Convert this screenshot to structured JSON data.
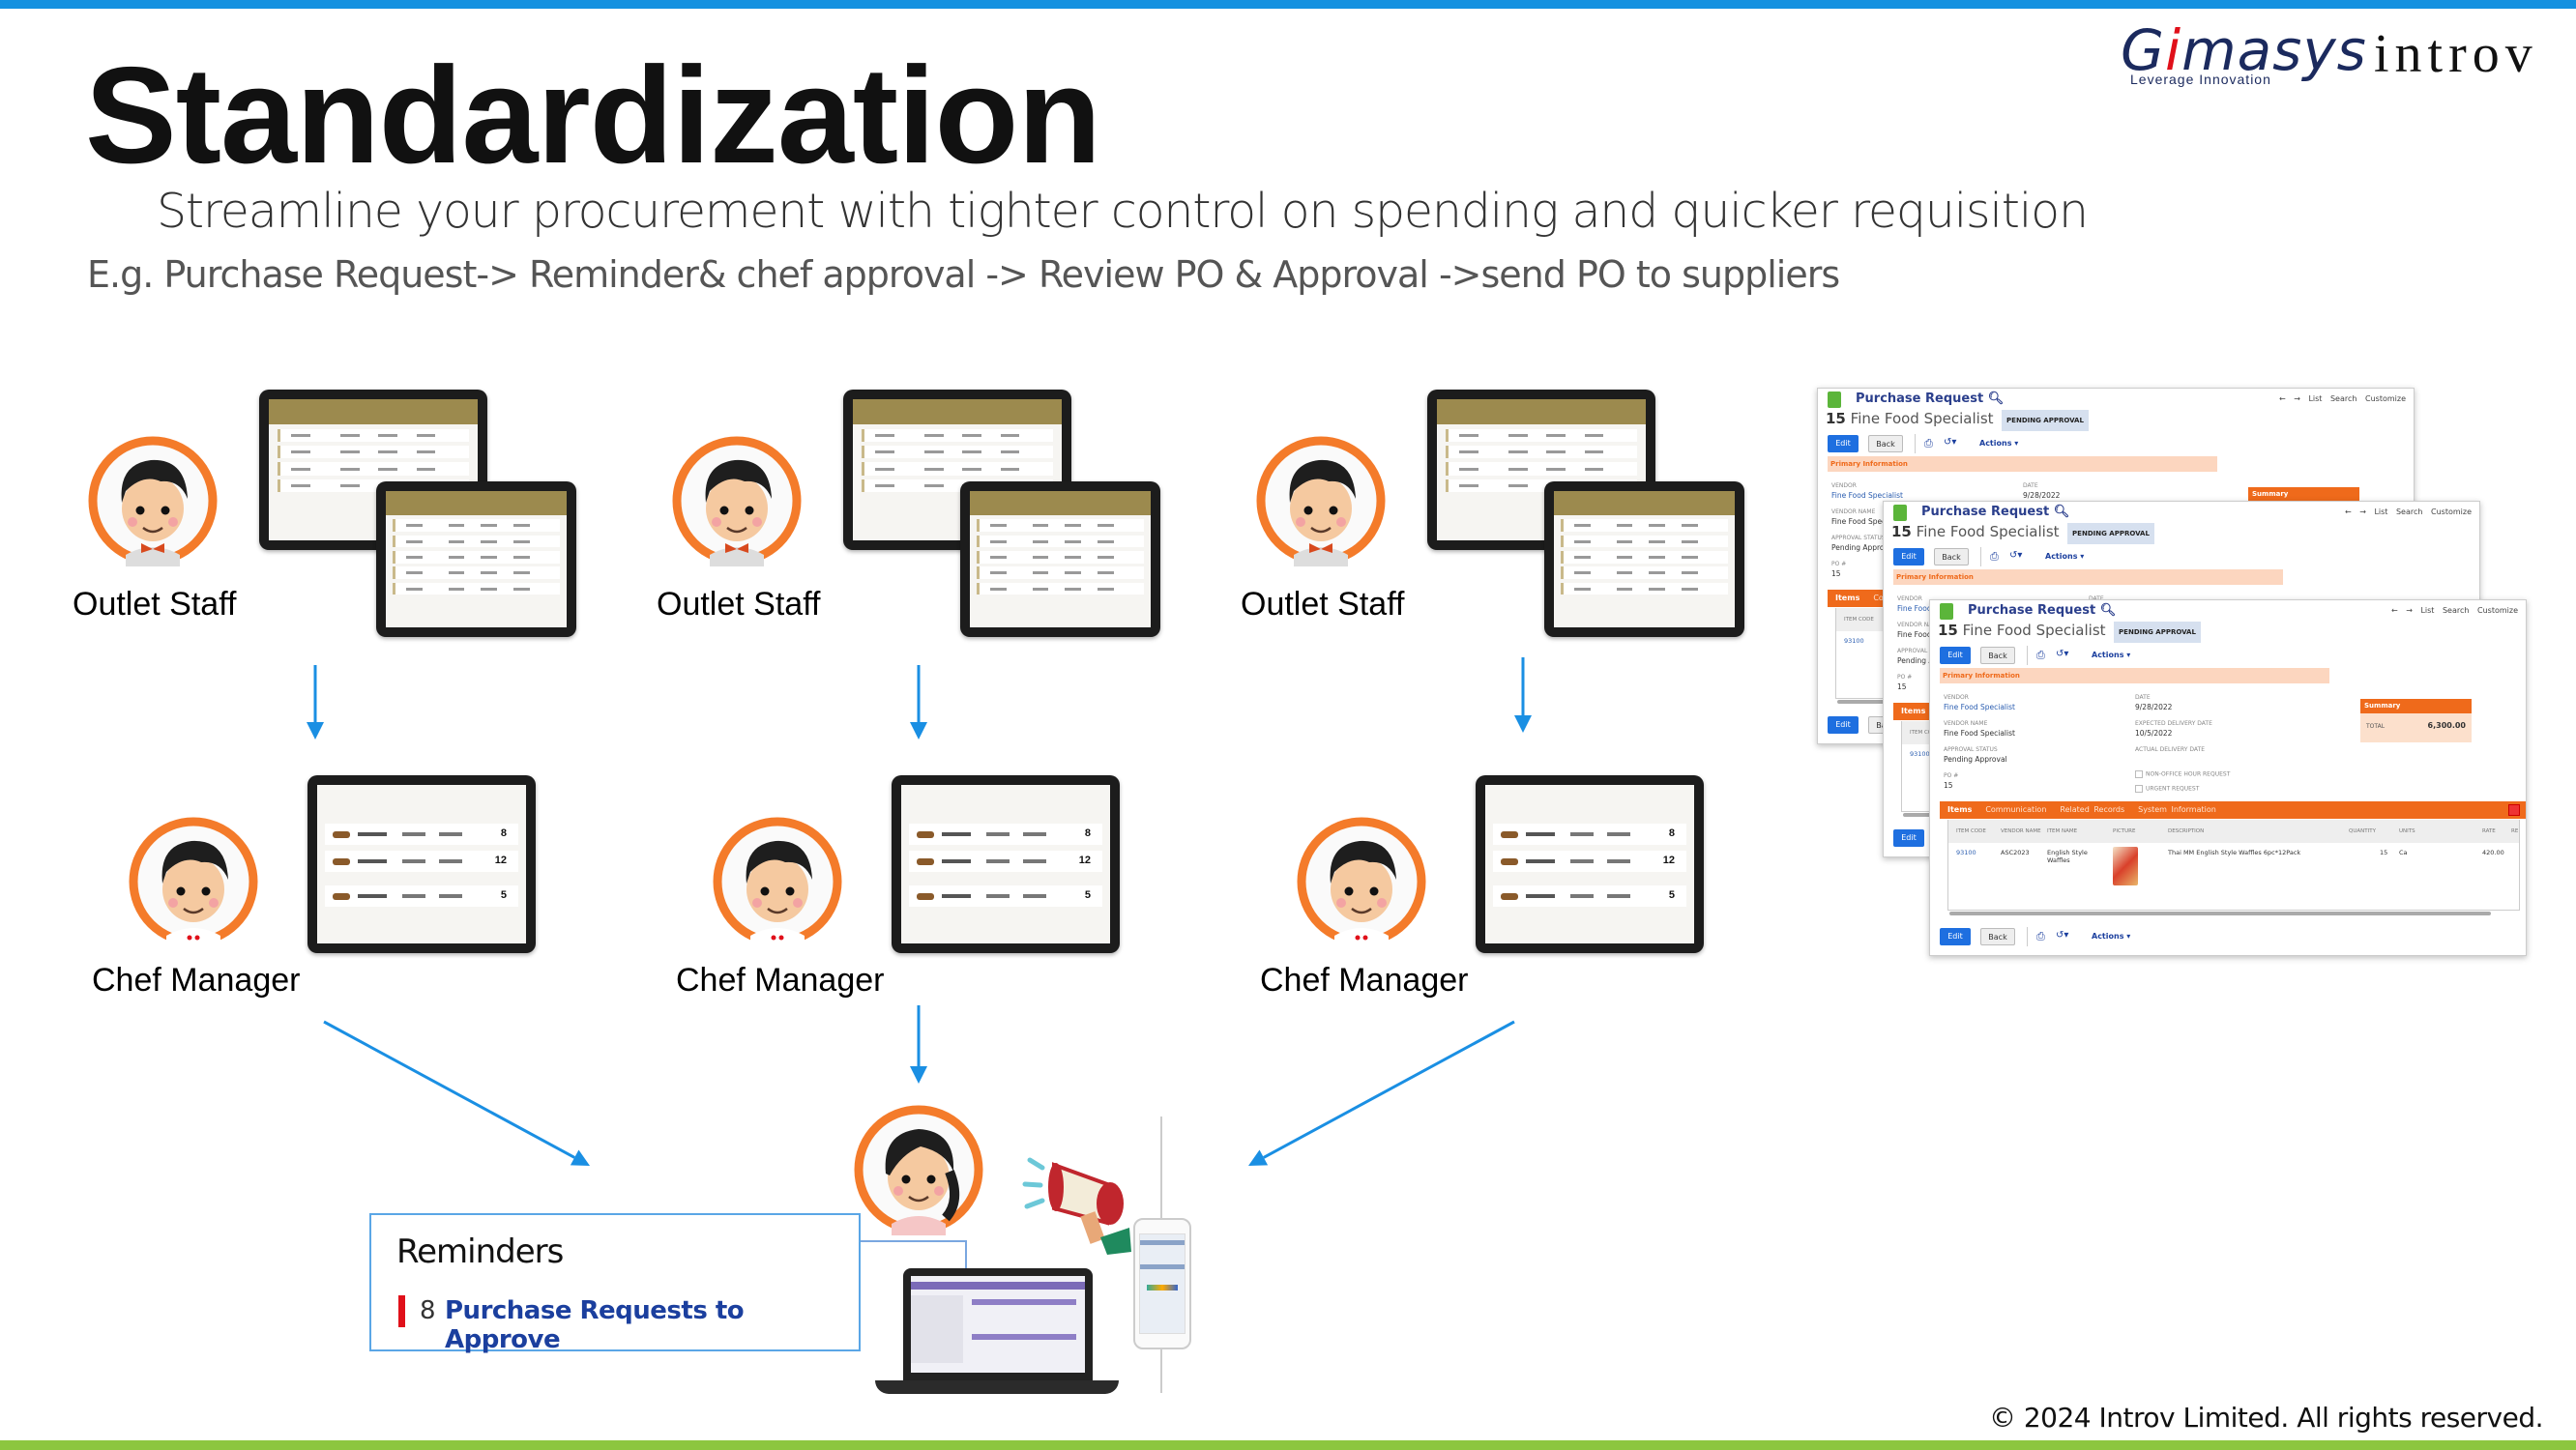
{
  "header": {
    "title": "Standardization",
    "subtitle": "Streamline your procurement with tighter control on spending and quicker requisition",
    "example": "E.g. Purchase Request-> Reminder& chef approval -> Review PO  & Approval ->send PO to suppliers"
  },
  "logos": {
    "gimasys_pre": "G",
    "gimasys_i": "i",
    "gimasys_post": "masys",
    "gimasys_tagline": "Leverage Innovation",
    "introv": "introv"
  },
  "colors": {
    "top_bar": "#1591e0",
    "bottom_bar": "#8cc63f",
    "avatar_ring": "#f47b2a",
    "arrow": "#1a8fe3",
    "pr_accent": "#ef6a1b"
  },
  "flows": [
    {
      "staff_label": "Outlet Staff",
      "manager_label": "Chef Manager",
      "quantities": [
        "8",
        "12",
        "5"
      ]
    },
    {
      "staff_label": "Outlet Staff",
      "manager_label": "Chef Manager",
      "quantities": [
        "8",
        "12",
        "5"
      ]
    },
    {
      "staff_label": "Outlet Staff",
      "manager_label": "Chef Manager",
      "quantities": [
        "8",
        "12",
        "5"
      ]
    }
  ],
  "reminders": {
    "title": "Reminders",
    "count": "8",
    "link": "Purchase Requests to Approve"
  },
  "purchase_request": {
    "title": "Purchase Request",
    "number": "15",
    "vendor_title": "Fine Food Specialist",
    "status_badge": "PENDING APPROVAL",
    "nav": {
      "list": "List",
      "search": "Search",
      "customize": "Customize"
    },
    "buttons": {
      "edit": "Edit",
      "back": "Back",
      "actions": "Actions ▾"
    },
    "section": "Primary Information",
    "fields": {
      "vendor_label": "VENDOR",
      "vendor": "Fine Food Specialist",
      "vendor_name_label": "VENDOR NAME",
      "vendor_name": "Fine Food Specialist",
      "approval_status_label": "APPROVAL STATUS",
      "approval_status": "Pending Approval",
      "po_label": "PO #",
      "po": "15",
      "date_label": "DATE",
      "date": "9/28/2022",
      "expected_label": "EXPECTED DELIVERY DATE",
      "expected": "10/5/2022",
      "actual_label": "ACTUAL DELIVERY DATE",
      "non_office_label": "NON-OFFICE HOUR REQUEST",
      "urgent_label": "URGENT REQUEST"
    },
    "summary": {
      "title": "Summary",
      "total_label": "TOTAL",
      "total": "6,300.00"
    },
    "tabs": [
      "Items",
      "Communication",
      "Related Records",
      "System Information"
    ],
    "columns": [
      "ITEM CODE",
      "VENDOR NAME",
      "ITEM NAME",
      "PICTURE",
      "DESCRIPTION",
      "QUANTITY",
      "UNITS",
      "RATE",
      "RE"
    ],
    "row": {
      "item_code": "93100",
      "vendor_name": "ASC2023",
      "item_name": "English Style Waffles",
      "description": "Thai MM English Style Waffles 6pc*12Pack",
      "quantity": "15",
      "units": "Ca",
      "rate": "420.00"
    }
  },
  "footer": {
    "copyright": "© 2024 Introv Limited. All rights reserved."
  }
}
